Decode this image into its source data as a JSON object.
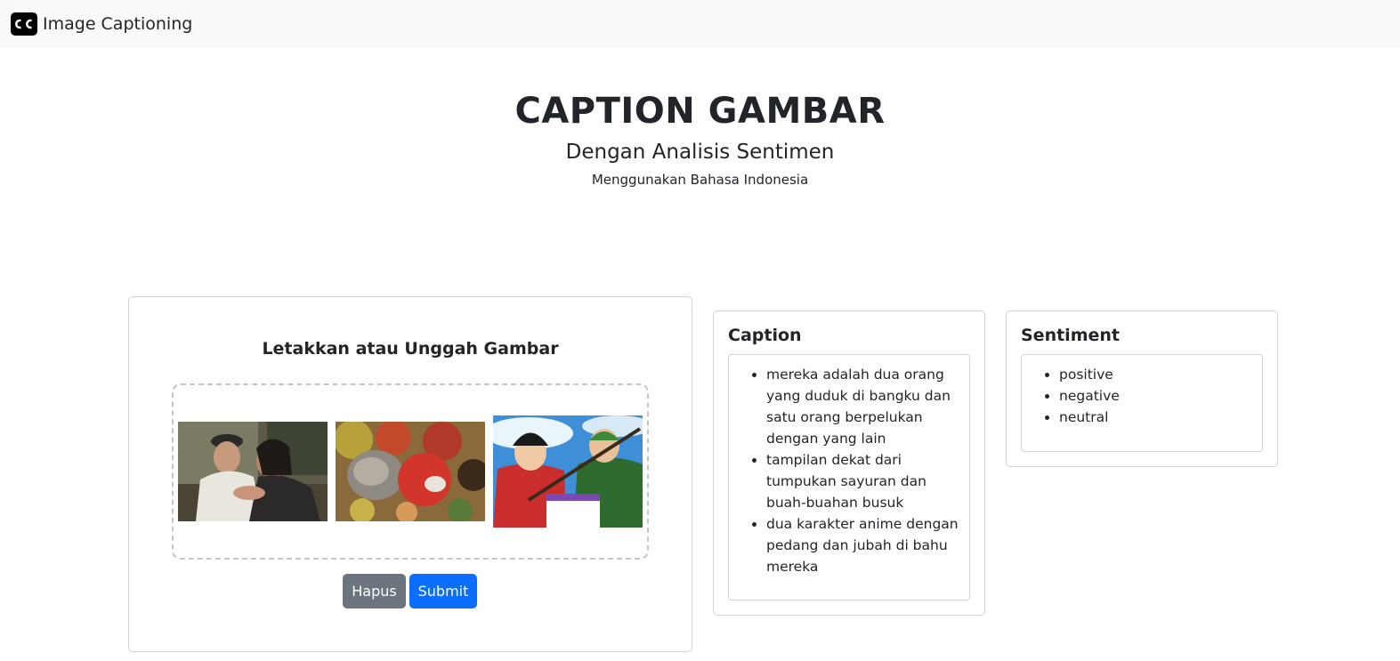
{
  "navbar": {
    "brand": "Image Captioning",
    "icon": "closed-captions-icon"
  },
  "hero": {
    "title": "CAPTION GAMBAR",
    "subtitle": "Dengan Analisis Sentimen",
    "note": "Menggunakan Bahasa Indonesia"
  },
  "upload": {
    "title": "Letakkan atau Unggah Gambar",
    "images": [
      "elderly-man-and-woman-hugging-photo",
      "rotten-vegetables-and-fruits-photo",
      "anime-characters-with-swords-image"
    ],
    "delete_label": "Hapus",
    "submit_label": "Submit"
  },
  "caption": {
    "title": "Caption",
    "items": [
      "mereka adalah dua orang yang duduk di bangku dan satu orang berpelukan dengan yang lain",
      "tampilan dekat dari tumpukan sayuran dan buah-buahan busuk",
      "dua karakter anime dengan pedang dan jubah di bahu mereka"
    ]
  },
  "sentiment": {
    "title": "Sentiment",
    "items": [
      "positive",
      "negative",
      "neutral"
    ]
  },
  "colors": {
    "navbar_bg": "#f8f9fa",
    "delete_button": "#6c757d",
    "submit_button": "#0d6efd",
    "border": "#ced4da"
  }
}
